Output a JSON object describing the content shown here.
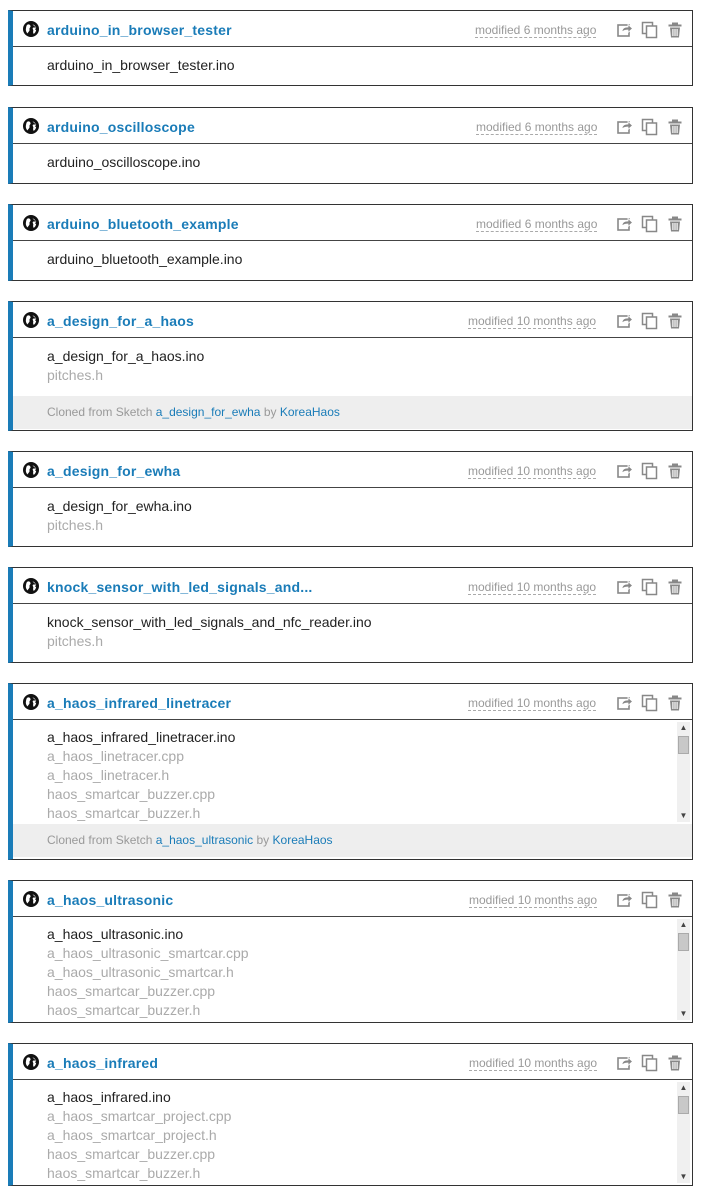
{
  "sketches": [
    {
      "title": "arduino_in_browser_tester",
      "modified": "modified 6 months ago",
      "files": [
        "arduino_in_browser_tester.ino"
      ]
    },
    {
      "title": "arduino_oscilloscope",
      "modified": "modified 6 months ago",
      "files": [
        "arduino_oscilloscope.ino"
      ]
    },
    {
      "title": "arduino_bluetooth_example",
      "modified": "modified 6 months ago",
      "files": [
        "arduino_bluetooth_example.ino"
      ]
    },
    {
      "title": "a_design_for_a_haos",
      "modified": "modified 10 months ago",
      "files": [
        "a_design_for_a_haos.ino",
        "pitches.h"
      ],
      "cloned": {
        "prefix": "Cloned from Sketch",
        "sketch": "a_design_for_ewha",
        "by": "by",
        "user": "KoreaHaos"
      }
    },
    {
      "title": "a_design_for_ewha",
      "modified": "modified 10 months ago",
      "files": [
        "a_design_for_ewha.ino",
        "pitches.h"
      ]
    },
    {
      "title": "knock_sensor_with_led_signals_and...",
      "modified": "modified 10 months ago",
      "files": [
        "knock_sensor_with_led_signals_and_nfc_reader.ino",
        "pitches.h"
      ]
    },
    {
      "title": "a_haos_infrared_linetracer",
      "modified": "modified 10 months ago",
      "files": [
        "a_haos_infrared_linetracer.ino",
        "a_haos_linetracer.cpp",
        "a_haos_linetracer.h",
        "haos_smartcar_buzzer.cpp",
        "haos_smartcar_buzzer.h"
      ],
      "cloned": {
        "prefix": "Cloned from Sketch",
        "sketch": "a_haos_ultrasonic",
        "by": "by",
        "user": "KoreaHaos"
      }
    },
    {
      "title": "a_haos_ultrasonic",
      "modified": "modified 10 months ago",
      "files": [
        "a_haos_ultrasonic.ino",
        "a_haos_ultrasonic_smartcar.cpp",
        "a_haos_ultrasonic_smartcar.h",
        "haos_smartcar_buzzer.cpp",
        "haos_smartcar_buzzer.h"
      ]
    },
    {
      "title": "a_haos_infrared",
      "modified": "modified 10 months ago",
      "files": [
        "a_haos_infrared.ino",
        "a_haos_smartcar_project.cpp",
        "a_haos_smartcar_project.h",
        "haos_smartcar_buzzer.cpp",
        "haos_smartcar_buzzer.h"
      ]
    }
  ],
  "icons": {
    "public": "globe-icon",
    "share": "share-icon",
    "clone": "clone-icon",
    "delete": "trash-icon"
  },
  "colors": {
    "accent": "#1a7cb8",
    "muted_text": "#999999",
    "cloned_bg": "#eeeeee"
  }
}
